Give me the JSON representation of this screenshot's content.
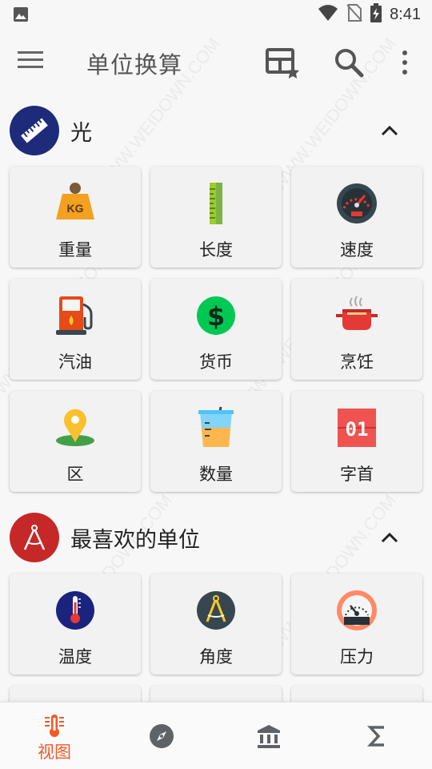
{
  "status_bar": {
    "time": "8:41"
  },
  "app_bar": {
    "title": "单位换算"
  },
  "sections": [
    {
      "title": "光",
      "avatar_color": "#1e2a7a",
      "icon": "ruler-icon",
      "tiles": [
        {
          "label": "重量",
          "icon": "weight-kg-icon"
        },
        {
          "label": "长度",
          "icon": "ruler-icon"
        },
        {
          "label": "速度",
          "icon": "speedometer-icon"
        },
        {
          "label": "汽油",
          "icon": "fuel-pump-icon"
        },
        {
          "label": "货币",
          "icon": "dollar-coin-icon"
        },
        {
          "label": "烹饪",
          "icon": "cooking-pot-icon"
        },
        {
          "label": "区",
          "icon": "map-pin-icon"
        },
        {
          "label": "数量",
          "icon": "measuring-cup-icon"
        },
        {
          "label": "字首",
          "icon": "binary-digits-icon"
        }
      ]
    },
    {
      "title": "最喜欢的单位",
      "avatar_color": "#c62828",
      "icon": "compass-drawing-icon",
      "tiles": [
        {
          "label": "温度",
          "icon": "thermometer-icon"
        },
        {
          "label": "角度",
          "icon": "compass-drawing-icon"
        },
        {
          "label": "压力",
          "icon": "pressure-gauge-icon"
        }
      ]
    }
  ],
  "bottom_nav": {
    "items": [
      {
        "label": "视图",
        "icon": "thermometer-nav-icon",
        "active": true
      },
      {
        "label": "",
        "icon": "compass-nav-icon",
        "active": false
      },
      {
        "label": "",
        "icon": "bank-icon",
        "active": false
      },
      {
        "label": "",
        "icon": "sigma-icon",
        "active": false
      }
    ]
  },
  "colors": {
    "accent": "#ef5a2a",
    "tile_bg": "#f2f2f2",
    "background": "#f7f7f7"
  }
}
